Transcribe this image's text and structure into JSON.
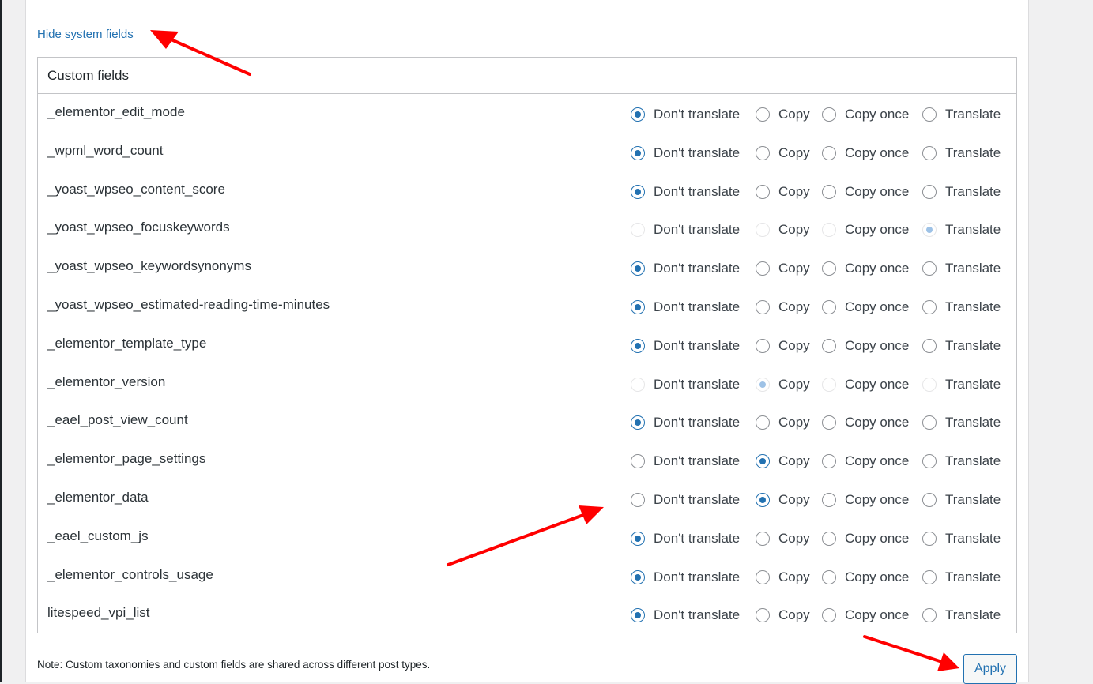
{
  "hide_link": "Hide system fields",
  "section_title": "Custom fields",
  "options": [
    "Don't translate",
    "Copy",
    "Copy once",
    "Translate"
  ],
  "rows": [
    {
      "name": "_elementor_edit_mode",
      "selected": 0,
      "disabled": false
    },
    {
      "name": "_wpml_word_count",
      "selected": 0,
      "disabled": false
    },
    {
      "name": "_yoast_wpseo_content_score",
      "selected": 0,
      "disabled": false
    },
    {
      "name": "_yoast_wpseo_focuskeywords",
      "selected": 3,
      "disabled": true
    },
    {
      "name": "_yoast_wpseo_keywordsynonyms",
      "selected": 0,
      "disabled": false
    },
    {
      "name": "_yoast_wpseo_estimated-reading-time-minutes",
      "selected": 0,
      "disabled": false
    },
    {
      "name": "_elementor_template_type",
      "selected": 0,
      "disabled": false
    },
    {
      "name": "_elementor_version",
      "selected": 1,
      "disabled": true
    },
    {
      "name": "_eael_post_view_count",
      "selected": 0,
      "disabled": false
    },
    {
      "name": "_elementor_page_settings",
      "selected": 1,
      "disabled": false
    },
    {
      "name": "_elementor_data",
      "selected": 1,
      "disabled": false
    },
    {
      "name": "_eael_custom_js",
      "selected": 0,
      "disabled": false
    },
    {
      "name": "_elementor_controls_usage",
      "selected": 0,
      "disabled": false
    },
    {
      "name": "litespeed_vpi_list",
      "selected": 0,
      "disabled": false
    }
  ],
  "note": "Note: Custom taxonomies and custom fields are shared across different post types.",
  "apply_label": "Apply",
  "colors": {
    "accent": "#2271b1",
    "annotation_arrow": "#ff0000"
  }
}
